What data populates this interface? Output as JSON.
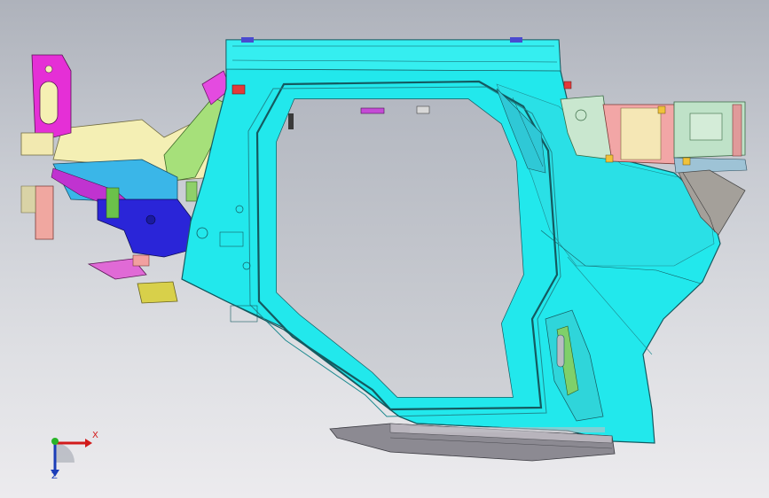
{
  "viewport": {
    "background_top": "#aeb2bb",
    "background_bottom": "#ecebee"
  },
  "model": {
    "name": "body-side-assembly",
    "main_panel_color": "#22e8ec",
    "outline_color": "#1a5f66",
    "accent_colors": {
      "magenta": "#e52fd6",
      "blue": "#2a25d8",
      "yellow": "#f5f0b3",
      "green": "#9fe06b",
      "pink": "#f2a6a6",
      "sage": "#bfe2c8",
      "steel": "#9ec3d6",
      "red": "#e23a3a",
      "dark": "#6a6a72"
    }
  },
  "triad": {
    "x_label": "X",
    "z_label": "Z",
    "x_color": "#d21a1a",
    "y_color": "#28b428",
    "z_color": "#1b3db8",
    "icon": "view-orientation-triad-icon"
  }
}
